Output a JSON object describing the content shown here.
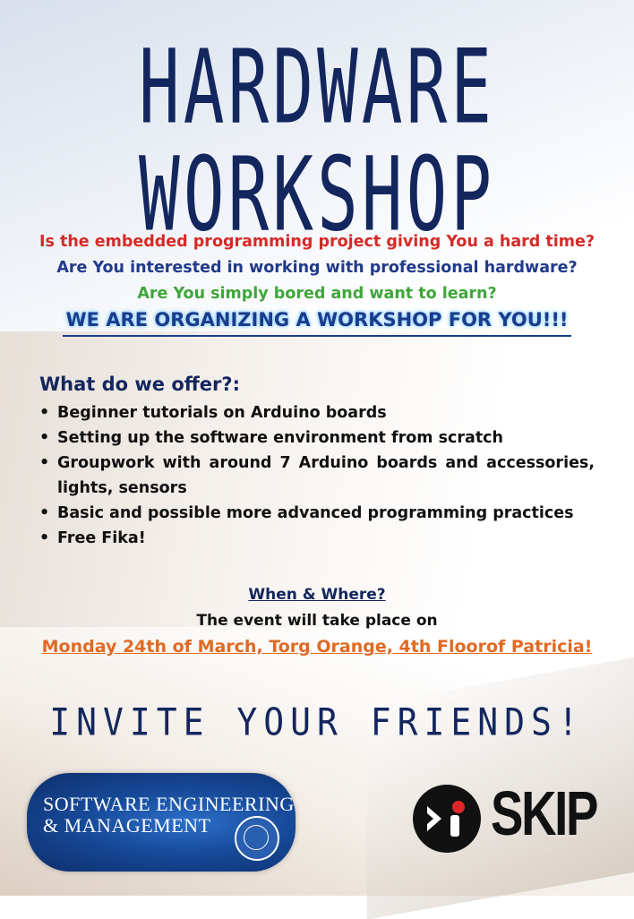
{
  "poster": {
    "title_line1": "HARDWARE",
    "title_line2": "WORKSHOP",
    "question_1": "Is the embedded programming project giving You a hard time?",
    "question_2": "Are You interested in working with professional hardware?",
    "question_3": "Are You simply bored and want to learn?",
    "announcement": "WE ARE ORGANIZING A WORKSHOP FOR YOU!!!",
    "offer_heading": "What do we offer?:",
    "offer_items": [
      "Beginner tutorials on Arduino boards",
      "Setting up the software environment from scratch",
      "Groupwork with around 7 Arduino boards and accessories, lights, sensors",
      "Basic and possible more advanced programming practices",
      "Free Fika!"
    ],
    "bullet": "•",
    "when_heading": "When & Where?",
    "event_line": "The event will take place on",
    "date_line": "Monday 24th of March, Torg Orange, 4th Floorof  Patricia!",
    "invite": "INVITE YOUR FRIENDS!",
    "sem_logo_line1": "SOFTWARE ENGINEERING",
    "sem_logo_line2": "& MANAGEMENT",
    "skip_logo_text": "SKIP"
  },
  "colors": {
    "navy": "#13265e",
    "red": "#d62a26",
    "blue": "#213a8a",
    "green": "#3fa63a",
    "orange": "#e06a24"
  },
  "icons": {
    "university_seal": "university-seal-icon",
    "skip_mark": "skip-mark-icon"
  }
}
